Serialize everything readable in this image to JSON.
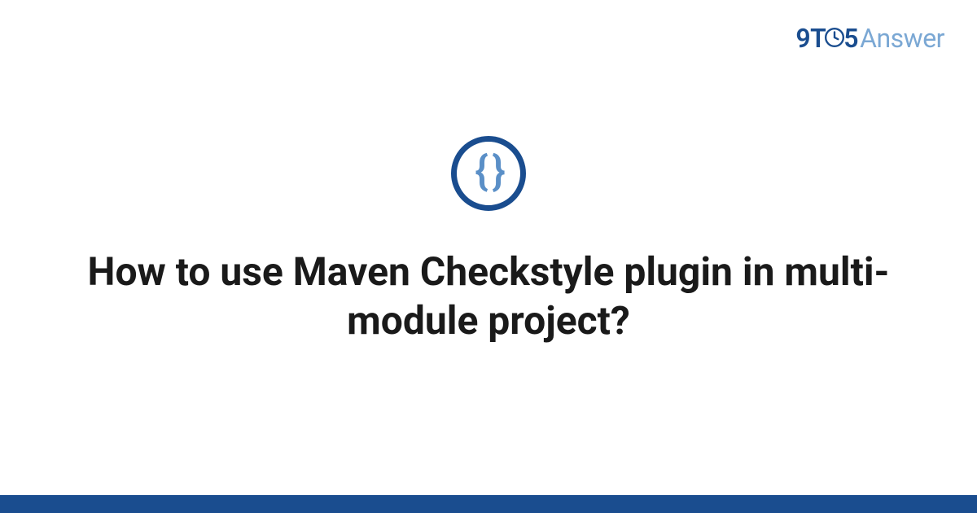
{
  "logo": {
    "part1": "9T",
    "part2": "5",
    "part3": "Answer"
  },
  "icon": {
    "name": "code-braces-icon",
    "glyph": "{ }"
  },
  "title": "How to use Maven Checkstyle plugin in multi-module project?",
  "colors": {
    "brand_primary": "#1a4d8f",
    "brand_light": "#7ba8d4",
    "icon_inner": "#5a8fc7"
  }
}
